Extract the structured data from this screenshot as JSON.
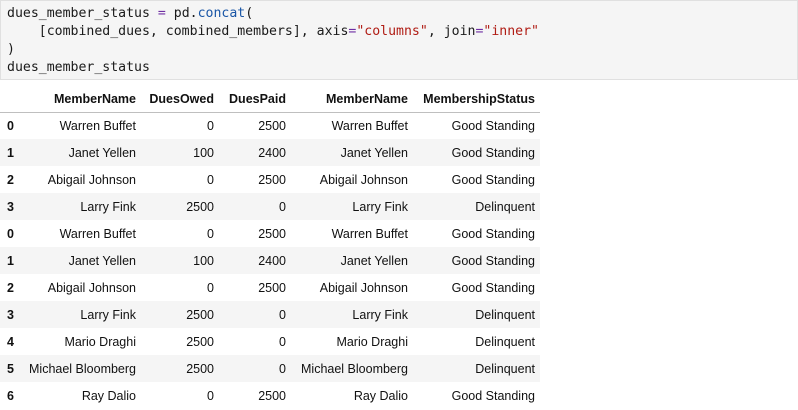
{
  "code": {
    "line1": {
      "a": "dues_member_status ",
      "op": "=",
      "b": " pd.",
      "fn": "concat",
      "c": "("
    },
    "line2": {
      "a": "    [combined_dues, combined_members], axis",
      "op1": "=",
      "s1": "\"columns\"",
      "b": ", join",
      "op2": "=",
      "s2": "\"inner\""
    },
    "line3": ")",
    "line4": "dues_member_status"
  },
  "table": {
    "columns": [
      "",
      "MemberName",
      "DuesOwed",
      "DuesPaid",
      "MemberName",
      "MembershipStatus"
    ],
    "rows": [
      [
        "0",
        "Warren Buffet",
        "0",
        "2500",
        "Warren Buffet",
        "Good Standing"
      ],
      [
        "1",
        "Janet Yellen",
        "100",
        "2400",
        "Janet Yellen",
        "Good Standing"
      ],
      [
        "2",
        "Abigail Johnson",
        "0",
        "2500",
        "Abigail Johnson",
        "Good Standing"
      ],
      [
        "3",
        "Larry Fink",
        "2500",
        "0",
        "Larry Fink",
        "Delinquent"
      ],
      [
        "0",
        "Warren Buffet",
        "0",
        "2500",
        "Warren Buffet",
        "Good Standing"
      ],
      [
        "1",
        "Janet Yellen",
        "100",
        "2400",
        "Janet Yellen",
        "Good Standing"
      ],
      [
        "2",
        "Abigail Johnson",
        "0",
        "2500",
        "Abigail Johnson",
        "Good Standing"
      ],
      [
        "3",
        "Larry Fink",
        "2500",
        "0",
        "Larry Fink",
        "Delinquent"
      ],
      [
        "4",
        "Mario Draghi",
        "2500",
        "0",
        "Mario Draghi",
        "Delinquent"
      ],
      [
        "5",
        "Michael Bloomberg",
        "2500",
        "0",
        "Michael Bloomberg",
        "Delinquent"
      ],
      [
        "6",
        "Ray Dalio",
        "0",
        "2500",
        "Ray Dalio",
        "Good Standing"
      ]
    ]
  }
}
